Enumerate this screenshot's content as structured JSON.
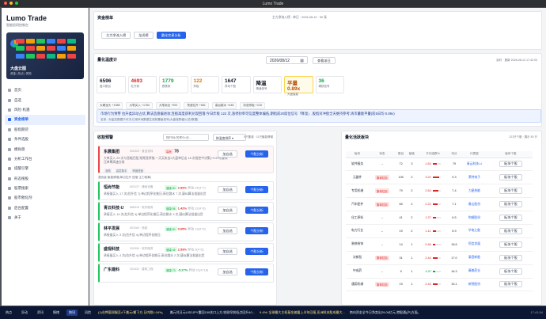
{
  "window": {
    "title": "Lumo Trade"
  },
  "brand": {
    "name": "Lumo Trade",
    "subtitle": "智能投研控制台"
  },
  "promo": {
    "title": "大盘云图",
    "sub": "资金 | 热点 | 风险"
  },
  "nav": [
    {
      "label": "首页"
    },
    {
      "label": "自选"
    },
    {
      "label": "风险·机遇"
    },
    {
      "label": "资金榜单"
    },
    {
      "label": "股指期货"
    },
    {
      "label": "条件选股"
    },
    {
      "label": "模拟盘"
    },
    {
      "label": "分析工作台"
    },
    {
      "label": "提醒引擎"
    },
    {
      "label": "形态搜股"
    },
    {
      "label": "股票搜索"
    },
    {
      "label": "股市催化剂"
    },
    {
      "label": "后台配置"
    },
    {
      "label": "关于"
    }
  ],
  "fundflow": {
    "title": "资金榜单",
    "info": "主力净流入榜 · 单日 · 2026-08-12 · 50 条",
    "tabs": [
      "主力净流入榜",
      "龙虎榜",
      "量化交易分析"
    ],
    "active_tab": 2
  },
  "quant": {
    "title": "量化温度计",
    "date": "2026/08/12",
    "query_btn": "查看该日",
    "updated": "实时 · 更新 2026-08-12 17:42:03",
    "metrics": [
      {
        "value": "6596",
        "label": "盘口数目",
        "color": "#111827"
      },
      {
        "value": "4693",
        "label": "红升家",
        "color": "#dc2626"
      },
      {
        "value": "1779",
        "label": "跌跌家",
        "color": "#16a34a"
      },
      {
        "value": "122",
        "label": "炸板",
        "color": "#d97706"
      },
      {
        "value": "1647",
        "label": "异动个股",
        "color": "#111827"
      },
      {
        "value": "降温",
        "label": "情绪信号",
        "color": "#111827"
      },
      {
        "value": "平量 0.89x",
        "label": "大盘量能",
        "color": "#b45309"
      },
      {
        "value": "36",
        "label": "硬核信号",
        "color": "#16a34a"
      }
    ],
    "pills": [
      "大硬龙头 +1988",
      "大笔买入 +1784",
      "大笔卖出 +992",
      "快速拉升 +681",
      "高台跳水 +448",
      "封涨停板 +218"
    ],
    "alert_main": "市场行为预警 拉升类异动占优,算法造盘偏进攻;连板高度获利兑现回落;今日炸板 122 次,涨停封单可信度整体偏低,期指前20席位信号「降温」,股指对冲盘全天维持参考;再市量能平量(较5日均 0.89x)",
    "alert_sub": "名前 : 对监控数据只可决,已用本地数据生成前置级信号(大盘涨跌幅/公告/数据)"
  },
  "watch": {
    "title": "收割预警",
    "search_placeholder": "搜代码/名称/行业...",
    "filter": "按温度排序",
    "count": "5只集卷 · 11只聚能健增",
    "group2": "潜伏量·聚能健增(单边拉升·回落·主力吸筹)",
    "add_label": "加自选",
    "go_label": "个股分析",
    "stocks": [
      {
        "name": "东晨集团",
        "code": "002329 · 食品饮料",
        "tag": "高危",
        "score": "78",
        "desc": "大单买入 25 次与涨幅巴配,频频涨停推;一天买卖出2大盘单后击 18 次指控中决策(+9.9%),疑似压单筹高速交易",
        "tags2": [
          "涨嘴",
          "高层推手",
          "情绪提速"
        ]
      },
      {
        "name": "恒尚节能",
        "code": "603137 · 通信设备",
        "tag": "健康 80",
        "change": "2.83%",
        "extra": "异动 24(4↑7)",
        "desc": "承接量买入 17 次(拉升信 7),单边程序化推压;高位跳水 7 次,疑似算法批量出货"
      },
      {
        "name": "青云科技-U",
        "code": "688316 · 软件服务",
        "tag": "健康 58",
        "change": "1.42%",
        "extra": "异动 12(4↑8)",
        "desc": "承接买入 14 次(拉升信 4),单边程序化推压;高台跳水 3 次,疑似算法批量出货"
      },
      {
        "name": "林平发展",
        "code": "603284 · 造纸",
        "tag": "健康 80",
        "change": "0.65%",
        "extra": "异动 13(4↑9)",
        "desc": "承接量买入 9 次(拉升信 4),单边程序化推压;"
      },
      {
        "name": "盛视科技",
        "code": "002990 · 软件服务",
        "tag": "健康 48",
        "change": "2.53%",
        "extra": "异动 9(4↑5)",
        "desc": "承接量买入 4 次(拉升信 4),单边程序化推压;高台跳水 2 次,疑似算法批量出货"
      },
      {
        "name": "广东建科",
        "code": "301632 · 建筑工程",
        "tag": "健康 73",
        "change": "-5.27%",
        "extra": "异动 21(4↑16)",
        "desc": ""
      }
    ]
  },
  "sectors": {
    "title": "量化活跃板块",
    "count": "121只个股 · 展示 50 只",
    "headers": [
      "板块",
      "状态",
      "数目",
      "破破",
      "平均涨跌%",
      "均分",
      "代表股",
      "板块个股"
    ],
    "action_label": "板块个股",
    "rows": [
      {
        "name": "软件服务",
        "status": "--",
        "n": "72",
        "b": "3",
        "pct": "1.64",
        "score": "79",
        "rep": "青云科技-U",
        "dir": "up",
        "fill": "0.55"
      },
      {
        "name": "元器件",
        "status": "集体拉抬",
        "n": "105",
        "b": "2",
        "pct": "3.22",
        "score": "9.3",
        "rep": "莱特电子",
        "dir": "up",
        "fill": "0.8"
      },
      {
        "name": "专用机械",
        "status": "集体拉抬",
        "n": "79",
        "b": "2",
        "pct": "2.64",
        "score": "7.4",
        "rep": "力星热能",
        "dir": "up",
        "fill": "0.7"
      },
      {
        "name": "汽车配件",
        "status": "集体拉抬",
        "n": "65",
        "b": "2",
        "pct": "2.22",
        "score": "7.1",
        "rep": "春山股份",
        "dir": "up",
        "fill": "0.6"
      },
      {
        "name": "化工原料",
        "status": "--",
        "n": "41",
        "b": "2",
        "pct": "1.27",
        "score": "6.5",
        "rep": "和顺股份",
        "dir": "up",
        "fill": "0.45"
      },
      {
        "name": "电力行业",
        "status": "--",
        "n": "19",
        "b": "2",
        "pct": "1.11",
        "score": "5.9",
        "rep": "华电江能",
        "dir": "up",
        "fill": "0.4"
      },
      {
        "name": "装修装饰",
        "status": "--",
        "n": "14",
        "b": "1",
        "pct": "0.46",
        "score": "18.6",
        "rep": "恒信发展",
        "dir": "up",
        "fill": "0.3"
      },
      {
        "name": "次新股",
        "status": "集体拉抬",
        "n": "31",
        "b": "1",
        "pct": "2.44",
        "score": "17.0",
        "rep": "泰登新能",
        "dir": "up",
        "fill": "0.65"
      },
      {
        "name": "中成药",
        "status": "--",
        "n": "9",
        "b": "1",
        "pct": "-0.87",
        "score": "16.3",
        "rep": "康美药业",
        "dir": "down",
        "fill": "0.3"
      },
      {
        "name": "通用机械",
        "status": "集体拉抬",
        "n": "19",
        "b": "1",
        "pct": "2.44",
        "score": "15.1",
        "rep": "新锐股份",
        "dir": "up",
        "fill": "0.65"
      }
    ]
  },
  "ticker": {
    "tabs": [
      "热点",
      "异动",
      "资讯",
      "情绪",
      "快讯",
      "风险"
    ],
    "active": 4,
    "msg": "(1)仓钾菌润服至4下美元/桶下方,日内跌1.04%。",
    "msg2": "美元兑日元USDJPY重回159关口上方,较刚早前低点回升40...",
    "msg3": "9.4%! 全球最大主权基金披露上半年回报,亚洲科技股成最大...",
    "msg4": "南向资金全今日净卖出29.06亿元,港股通(沪)方面。",
    "time": "17:41:54"
  },
  "colors": {
    "accent": "#2563eb",
    "up": "#dc2626",
    "down": "#16a34a"
  }
}
